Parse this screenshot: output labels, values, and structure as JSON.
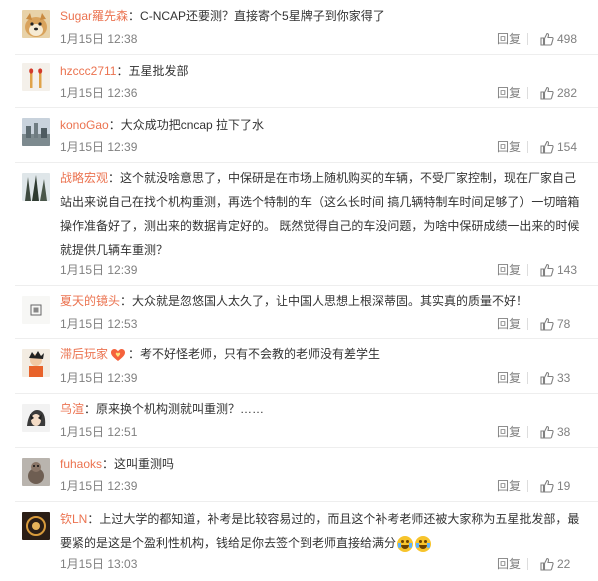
{
  "comments": [
    {
      "user": "Sugar羅先森",
      "text": "：C-NCAP还要测？直接寄个5星牌子到你家得了",
      "time": "1月15日 12:38",
      "reply": "回复",
      "likes": "498"
    },
    {
      "user": "hzccc2711",
      "text": "：五星批发部",
      "time": "1月15日 12:36",
      "reply": "回复",
      "likes": "282"
    },
    {
      "user": "konoGao",
      "text": "：大众成功把cncap 拉下了水",
      "time": "1月15日 12:39",
      "reply": "回复",
      "likes": "154"
    },
    {
      "user": "战略宏观",
      "text": "：这个就没啥意思了，中保研是在市场上随机购买的车辆，不受厂家控制，现在厂家自己站出来说自己在找个机构重测，再选个特制的车（这么长时间 搞几辆特制车时间足够了）一切暗箱操作准备好了，测出来的数据肯定好的。  既然觉得自己的车没问题，为啥中保研成绩一出来的时候就提供几辆车重测？",
      "time": "1月15日 12:39",
      "reply": "回复",
      "likes": "143"
    },
    {
      "user": "夏天的镜头",
      "text": "：大众就是忽悠国人太久了，让中国人思想上根深蒂固。其实真的质量不好！",
      "time": "1月15日 12:53",
      "reply": "回复",
      "likes": "78"
    },
    {
      "user": "滞后玩家",
      "text": "：考不好怪老师，只有不会教的老师没有差学生",
      "time": "1月15日 12:39",
      "reply": "回复",
      "likes": "33"
    },
    {
      "user": "乌渲",
      "text": "：原来换个机构测就叫重测？……",
      "time": "1月15日 12:51",
      "reply": "回复",
      "likes": "38"
    },
    {
      "user": "fuhaoks",
      "text": "：这叫重测吗",
      "time": "1月15日 12:39",
      "reply": "回复",
      "likes": "19"
    },
    {
      "user": "钦LN",
      "text": "：上过大学的都知道，补考是比较容易过的，而且这个补考老师还被大家称为五星批发部，最要紧的是这是个盈利性机构，钱给足你去签个到老师直接给满分",
      "time": "1月15日 13:03",
      "reply": "回复",
      "likes": "22"
    }
  ],
  "icons": {
    "like": "thumbs-up-icon",
    "vip": "vip-badge-icon",
    "emoji": "laugh-cry-emoji-icon"
  },
  "colors": {
    "username": "#eb7350",
    "meta": "#808080",
    "text": "#333333",
    "divider": "#eeeeee"
  }
}
